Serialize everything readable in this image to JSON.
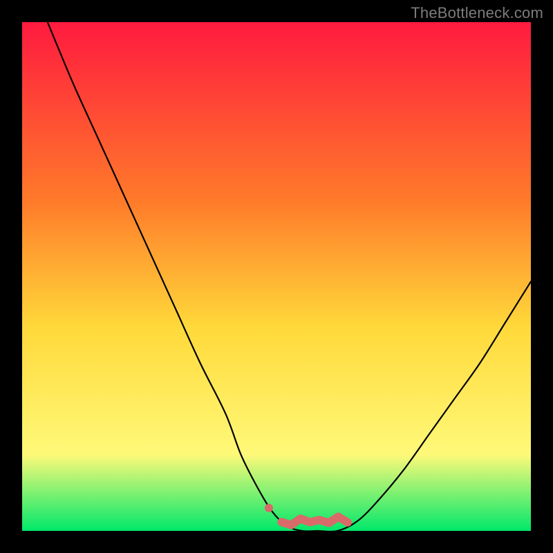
{
  "watermark": "TheBottleneck.com",
  "colors": {
    "frame": "#000000",
    "gradient_top": "#ff1a3f",
    "gradient_mid_upper": "#ff7a2a",
    "gradient_mid": "#ffd93a",
    "gradient_mid_lower": "#fff979",
    "gradient_bottom": "#00e86a",
    "curve": "#000000",
    "marker": "#d96a6a",
    "watermark_text": "#7c7c7c"
  },
  "chart_data": {
    "type": "line",
    "title": "",
    "xlabel": "",
    "ylabel": "",
    "xlim": [
      0,
      100
    ],
    "ylim": [
      0,
      100
    ],
    "series": [
      {
        "name": "bottleneck-curve",
        "x": [
          5,
          10,
          15,
          20,
          25,
          30,
          35,
          40,
          43,
          46,
          49,
          52,
          55,
          58,
          62,
          66,
          70,
          75,
          80,
          85,
          90,
          95,
          100
        ],
        "values": [
          100,
          88,
          77,
          66,
          55,
          44,
          33,
          23,
          15,
          9,
          4,
          1,
          0,
          0,
          0,
          2,
          6,
          12,
          19,
          26,
          33,
          41,
          49
        ]
      }
    ],
    "markers": [
      {
        "name": "left-dot",
        "x": 48.5,
        "y": 4.5
      },
      {
        "name": "wavy-start",
        "x": 51,
        "y": 1.5
      },
      {
        "name": "wavy-end",
        "x": 64,
        "y": 2.0
      }
    ],
    "annotations": []
  }
}
